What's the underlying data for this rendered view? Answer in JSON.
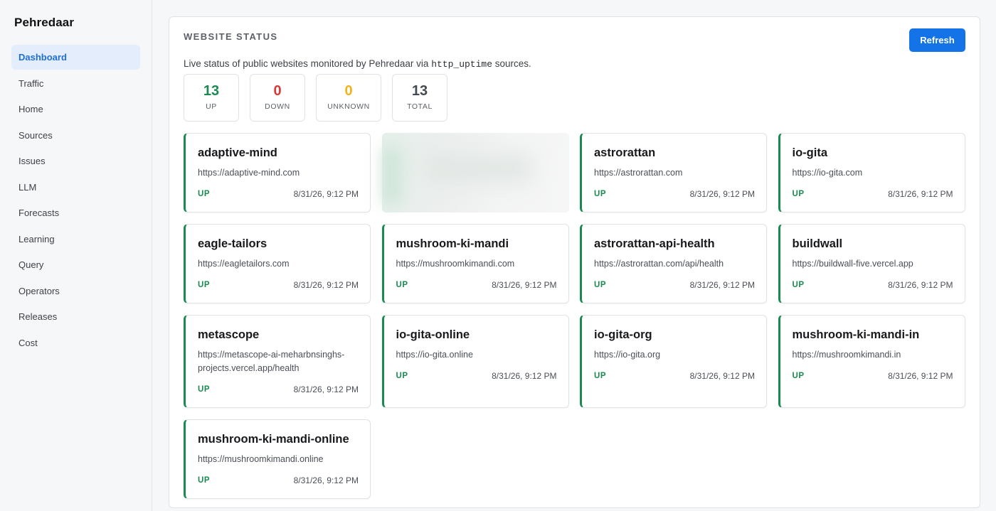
{
  "app": {
    "name": "Pehredaar"
  },
  "sidebar": {
    "items": [
      {
        "label": "Dashboard",
        "active": true
      },
      {
        "label": "Traffic"
      },
      {
        "label": "Home"
      },
      {
        "label": "Sources"
      },
      {
        "label": "Issues"
      },
      {
        "label": "LLM"
      },
      {
        "label": "Forecasts"
      },
      {
        "label": "Learning"
      },
      {
        "label": "Query"
      },
      {
        "label": "Operators"
      },
      {
        "label": "Releases"
      },
      {
        "label": "Cost"
      }
    ]
  },
  "panel": {
    "title": "WEBSITE STATUS",
    "refresh_label": "Refresh",
    "subtitle_before": "Live status of public websites monitored by Pehredaar via ",
    "subtitle_code": "http_uptime",
    "subtitle_after": " sources."
  },
  "summary": [
    {
      "value": "13",
      "label": "UP",
      "color": "#1a8a52"
    },
    {
      "value": "0",
      "label": "DOWN",
      "color": "#d63a3a"
    },
    {
      "value": "0",
      "label": "UNKNOWN",
      "color": "#f0b41c"
    },
    {
      "value": "13",
      "label": "TOTAL",
      "color": "#444a52"
    }
  ],
  "colors": {
    "accent": "#1473e6",
    "up": "#1a8a52",
    "down": "#d63a3a",
    "unknown": "#f0b41c"
  },
  "sites": [
    {
      "name": "adaptive-mind",
      "url": "https://adaptive-mind.com",
      "status": "UP",
      "time": "8/31/26, 9:12 PM"
    },
    {
      "name": "",
      "url": "",
      "status": "",
      "time": "",
      "obscured": true
    },
    {
      "name": "astrorattan",
      "url": "https://astrorattan.com",
      "status": "UP",
      "time": "8/31/26, 9:12 PM"
    },
    {
      "name": "io-gita",
      "url": "https://io-gita.com",
      "status": "UP",
      "time": "8/31/26, 9:12 PM"
    },
    {
      "name": "eagle-tailors",
      "url": "https://eagletailors.com",
      "status": "UP",
      "time": "8/31/26, 9:12 PM"
    },
    {
      "name": "mushroom-ki-mandi",
      "url": "https://mushroomkimandi.com",
      "status": "UP",
      "time": "8/31/26, 9:12 PM"
    },
    {
      "name": "astrorattan-api-health",
      "url": "https://astrorattan.com/api/health",
      "status": "UP",
      "time": "8/31/26, 9:12 PM"
    },
    {
      "name": "buildwall",
      "url": "https://buildwall-five.vercel.app",
      "status": "UP",
      "time": "8/31/26, 9:12 PM"
    },
    {
      "name": "metascope",
      "url": "https://metascope-ai-meharbnsinghs-projects.vercel.app/health",
      "status": "UP",
      "time": "8/31/26, 9:12 PM"
    },
    {
      "name": "io-gita-online",
      "url": "https://io-gita.online",
      "status": "UP",
      "time": "8/31/26, 9:12 PM"
    },
    {
      "name": "io-gita-org",
      "url": "https://io-gita.org",
      "status": "UP",
      "time": "8/31/26, 9:12 PM"
    },
    {
      "name": "mushroom-ki-mandi-in",
      "url": "https://mushroomkimandi.in",
      "status": "UP",
      "time": "8/31/26, 9:12 PM"
    },
    {
      "name": "mushroom-ki-mandi-online",
      "url": "https://mushroomkimandi.online",
      "status": "UP",
      "time": "8/31/26, 9:12 PM"
    }
  ]
}
